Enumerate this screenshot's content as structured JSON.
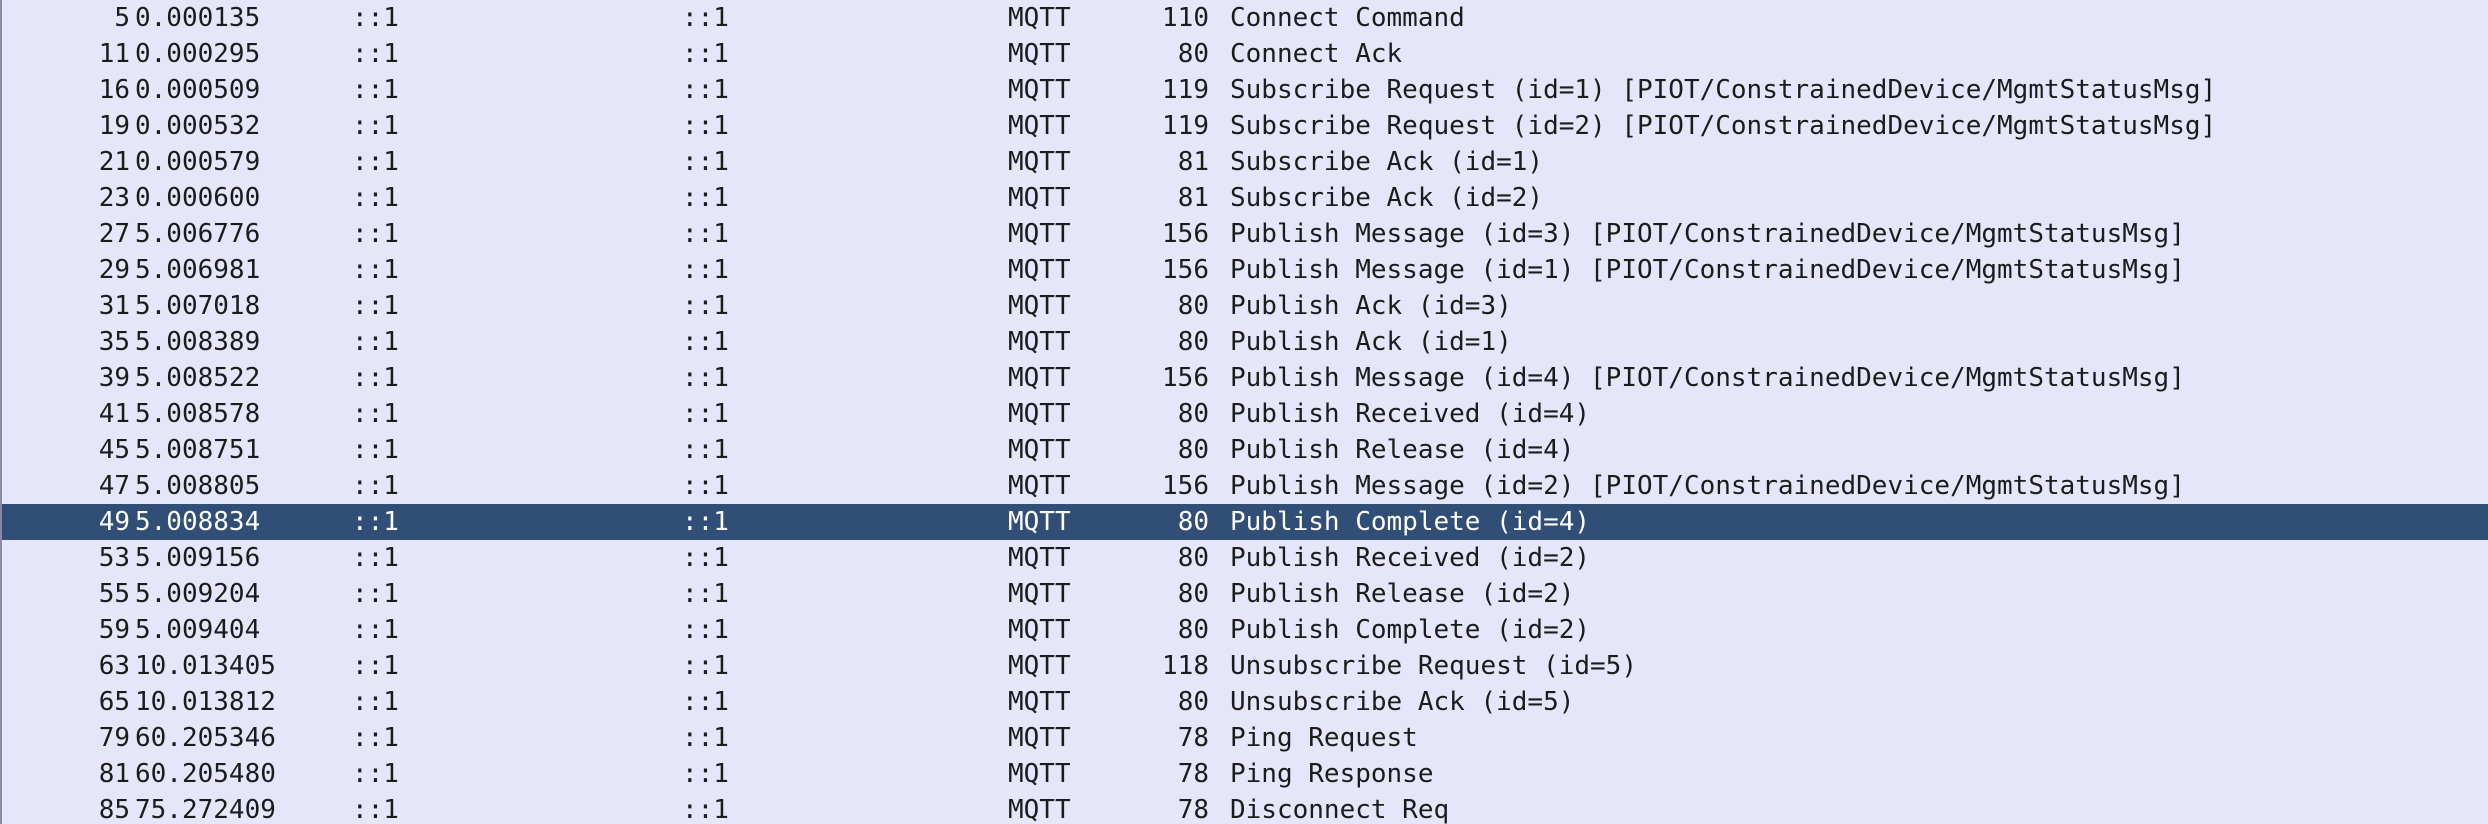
{
  "packets": [
    {
      "no": "5",
      "time": "0.000135",
      "source": "::1",
      "destination": "::1",
      "protocol": "MQTT",
      "length": "110",
      "info": "Connect Command"
    },
    {
      "no": "11",
      "time": "0.000295",
      "source": "::1",
      "destination": "::1",
      "protocol": "MQTT",
      "length": "80",
      "info": "Connect Ack"
    },
    {
      "no": "16",
      "time": "0.000509",
      "source": "::1",
      "destination": "::1",
      "protocol": "MQTT",
      "length": "119",
      "info": "Subscribe Request (id=1) [PIOT/ConstrainedDevice/MgmtStatusMsg]"
    },
    {
      "no": "19",
      "time": "0.000532",
      "source": "::1",
      "destination": "::1",
      "protocol": "MQTT",
      "length": "119",
      "info": "Subscribe Request (id=2) [PIOT/ConstrainedDevice/MgmtStatusMsg]"
    },
    {
      "no": "21",
      "time": "0.000579",
      "source": "::1",
      "destination": "::1",
      "protocol": "MQTT",
      "length": "81",
      "info": "Subscribe Ack (id=1)"
    },
    {
      "no": "23",
      "time": "0.000600",
      "source": "::1",
      "destination": "::1",
      "protocol": "MQTT",
      "length": "81",
      "info": "Subscribe Ack (id=2)"
    },
    {
      "no": "27",
      "time": "5.006776",
      "source": "::1",
      "destination": "::1",
      "protocol": "MQTT",
      "length": "156",
      "info": "Publish Message (id=3) [PIOT/ConstrainedDevice/MgmtStatusMsg]"
    },
    {
      "no": "29",
      "time": "5.006981",
      "source": "::1",
      "destination": "::1",
      "protocol": "MQTT",
      "length": "156",
      "info": "Publish Message (id=1) [PIOT/ConstrainedDevice/MgmtStatusMsg]"
    },
    {
      "no": "31",
      "time": "5.007018",
      "source": "::1",
      "destination": "::1",
      "protocol": "MQTT",
      "length": "80",
      "info": "Publish Ack (id=3)"
    },
    {
      "no": "35",
      "time": "5.008389",
      "source": "::1",
      "destination": "::1",
      "protocol": "MQTT",
      "length": "80",
      "info": "Publish Ack (id=1)"
    },
    {
      "no": "39",
      "time": "5.008522",
      "source": "::1",
      "destination": "::1",
      "protocol": "MQTT",
      "length": "156",
      "info": "Publish Message (id=4) [PIOT/ConstrainedDevice/MgmtStatusMsg]"
    },
    {
      "no": "41",
      "time": "5.008578",
      "source": "::1",
      "destination": "::1",
      "protocol": "MQTT",
      "length": "80",
      "info": "Publish Received (id=4)"
    },
    {
      "no": "45",
      "time": "5.008751",
      "source": "::1",
      "destination": "::1",
      "protocol": "MQTT",
      "length": "80",
      "info": "Publish Release (id=4)"
    },
    {
      "no": "47",
      "time": "5.008805",
      "source": "::1",
      "destination": "::1",
      "protocol": "MQTT",
      "length": "156",
      "info": "Publish Message (id=2) [PIOT/ConstrainedDevice/MgmtStatusMsg]"
    },
    {
      "no": "49",
      "time": "5.008834",
      "source": "::1",
      "destination": "::1",
      "protocol": "MQTT",
      "length": "80",
      "info": "Publish Complete (id=4)",
      "selected": true
    },
    {
      "no": "53",
      "time": "5.009156",
      "source": "::1",
      "destination": "::1",
      "protocol": "MQTT",
      "length": "80",
      "info": "Publish Received (id=2)"
    },
    {
      "no": "55",
      "time": "5.009204",
      "source": "::1",
      "destination": "::1",
      "protocol": "MQTT",
      "length": "80",
      "info": "Publish Release (id=2)"
    },
    {
      "no": "59",
      "time": "5.009404",
      "source": "::1",
      "destination": "::1",
      "protocol": "MQTT",
      "length": "80",
      "info": "Publish Complete (id=2)"
    },
    {
      "no": "63",
      "time": "10.013405",
      "source": "::1",
      "destination": "::1",
      "protocol": "MQTT",
      "length": "118",
      "info": "Unsubscribe Request (id=5)"
    },
    {
      "no": "65",
      "time": "10.013812",
      "source": "::1",
      "destination": "::1",
      "protocol": "MQTT",
      "length": "80",
      "info": "Unsubscribe Ack (id=5)"
    },
    {
      "no": "79",
      "time": "60.205346",
      "source": "::1",
      "destination": "::1",
      "protocol": "MQTT",
      "length": "78",
      "info": "Ping Request"
    },
    {
      "no": "81",
      "time": "60.205480",
      "source": "::1",
      "destination": "::1",
      "protocol": "MQTT",
      "length": "78",
      "info": "Ping Response"
    },
    {
      "no": "85",
      "time": "75.272409",
      "source": "::1",
      "destination": "::1",
      "protocol": "MQTT",
      "length": "78",
      "info": "Disconnect Req"
    }
  ],
  "colors": {
    "row_background": "#e6e6fa",
    "selected_background": "#304e76",
    "selected_text": "#ffffff",
    "text": "#1c1c1c"
  }
}
